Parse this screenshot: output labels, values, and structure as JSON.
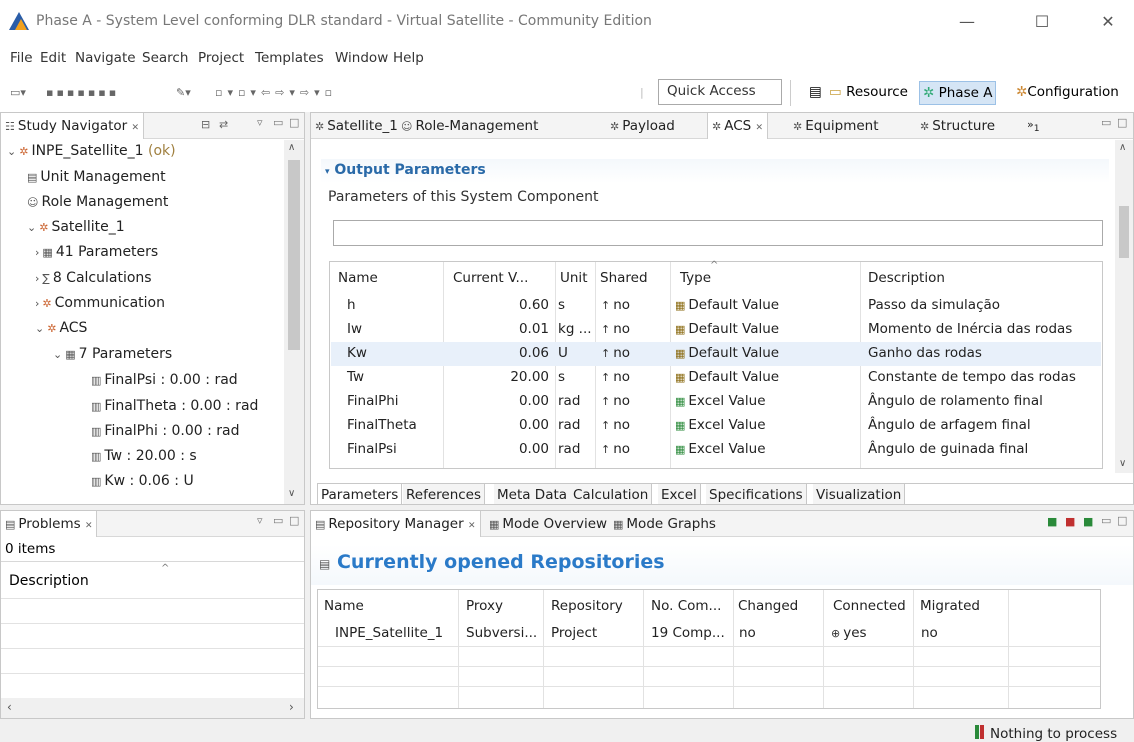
{
  "window": {
    "title": "Phase A - System Level conforming DLR standard - Virtual Satellite - Community Edition",
    "min": "—",
    "max": "☐",
    "close": "✕"
  },
  "menu": [
    "File",
    "Edit",
    "Navigate",
    "Search",
    "Project",
    "Templates",
    "Window",
    "Help"
  ],
  "toolbar": {
    "quick_access": "Quick Access"
  },
  "perspectives": [
    {
      "label": "Resource"
    },
    {
      "label": "Phase A"
    },
    {
      "label": "Configuration"
    }
  ],
  "navigator": {
    "tab": "Study Navigator",
    "close": "✕",
    "items": [
      {
        "text": "INPE_Satellite_1",
        "status": "(ok)",
        "arrow": "⌄",
        "icon": "study-icon"
      },
      {
        "text": "Unit Management",
        "icon": "unit-icon"
      },
      {
        "text": "Role Management",
        "icon": "role-icon"
      },
      {
        "text": "Satellite_1",
        "arrow": "⌄",
        "icon": "satellite-icon"
      },
      {
        "text": "41 Parameters",
        "arrow": "›",
        "icon": "parameters-icon"
      },
      {
        "text": "8 Calculations",
        "arrow": "›",
        "icon": "calculations-icon"
      },
      {
        "text": "Communication",
        "arrow": "›",
        "icon": "component-icon"
      },
      {
        "text": "ACS",
        "arrow": "⌄",
        "icon": "component-icon"
      },
      {
        "text": "7 Parameters",
        "arrow": "⌄",
        "icon": "parameters-icon"
      },
      {
        "text": "FinalPsi : 0.00 : rad",
        "icon": "parameter-icon"
      },
      {
        "text": "FinalTheta : 0.00 : rad",
        "icon": "parameter-icon"
      },
      {
        "text": "FinalPhi : 0.00 : rad",
        "icon": "parameter-icon"
      },
      {
        "text": "Tw : 20.00 : s",
        "icon": "parameter-icon"
      },
      {
        "text": "Kw : 0.06 : U",
        "icon": "parameter-icon"
      }
    ]
  },
  "editor": {
    "tabs": [
      "Satellite_1",
      "Role-Management",
      "Payload",
      "ACS",
      "Equipment",
      "Structure"
    ],
    "active_tab": "ACS",
    "overflow": "»",
    "overflow_count": "1",
    "section_title": "Output Parameters",
    "section_desc": "Parameters of this System Component",
    "filter": "",
    "columns": [
      "Name",
      "Current V...",
      "Unit",
      "Shared",
      "Type",
      "Description"
    ],
    "rows": [
      {
        "name": "h",
        "value": "0.60",
        "unit": "s",
        "shared": "no",
        "type": "Default Value",
        "desc": "Passo da simulação"
      },
      {
        "name": "Iw",
        "value": "0.01",
        "unit": "kg ...",
        "shared": "no",
        "type": "Default Value",
        "desc": "Momento de Inércia das rodas"
      },
      {
        "name": "Kw",
        "value": "0.06",
        "unit": "U",
        "shared": "no",
        "type": "Default Value",
        "desc": "Ganho das rodas"
      },
      {
        "name": "Tw",
        "value": "20.00",
        "unit": "s",
        "shared": "no",
        "type": "Default Value",
        "desc": "Constante de tempo das rodas"
      },
      {
        "name": "FinalPhi",
        "value": "0.00",
        "unit": "rad",
        "shared": "no",
        "type": "Excel Value",
        "desc": "Ângulo de rolamento final"
      },
      {
        "name": "FinalTheta",
        "value": "0.00",
        "unit": "rad",
        "shared": "no",
        "type": "Excel Value",
        "desc": "Ângulo de arfagem final"
      },
      {
        "name": "FinalPsi",
        "value": "0.00",
        "unit": "rad",
        "shared": "no",
        "type": "Excel Value",
        "desc": "Ângulo de guinada final"
      }
    ],
    "selected_row": 2,
    "subtabs": [
      "Parameters",
      "References",
      "Meta Data",
      "Calculation",
      "Excel",
      "Specifications",
      "Visualization"
    ]
  },
  "problems": {
    "tab": "Problems",
    "close": "✕",
    "count": "0 items",
    "column": "Description"
  },
  "repo": {
    "tabs": [
      "Repository Manager",
      "Mode Overview",
      "Mode Graphs"
    ],
    "title": "Currently opened Repositories",
    "columns": [
      "Name",
      "Proxy",
      "Repository",
      "No. Com...",
      "Changed",
      "Connected",
      "Migrated"
    ],
    "rows": [
      {
        "name": "INPE_Satellite_1",
        "proxy": "Subversi...",
        "repository": "Project",
        "nocom": "19 Comp...",
        "changed": "no",
        "connected": "yes",
        "migrated": "no"
      }
    ]
  },
  "status": {
    "text": "Nothing to process"
  }
}
